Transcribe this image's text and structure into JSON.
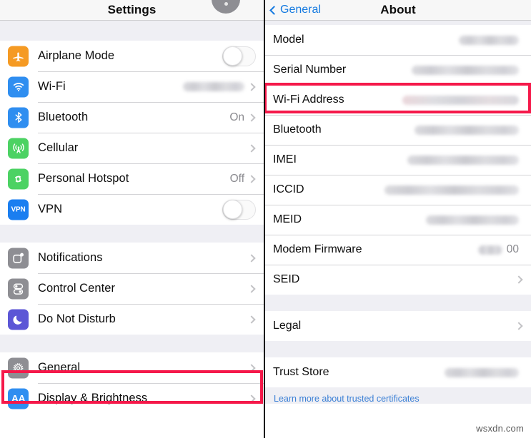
{
  "left_panel": {
    "nav": {
      "title": "Settings"
    },
    "groups": [
      {
        "items": [
          {
            "label": "Airplane Mode",
            "icon": "airplane-icon",
            "icon_color": "#f59a23",
            "accessory": "toggle",
            "toggle_on": false,
            "value": ""
          },
          {
            "label": "Wi-Fi",
            "icon": "wifi-icon",
            "icon_color": "#2f8ef0",
            "accessory": "chevron",
            "value": "",
            "redacted": true,
            "redact_width": 86
          },
          {
            "label": "Bluetooth",
            "icon": "bluetooth-icon",
            "icon_color": "#2f8ef0",
            "accessory": "chevron",
            "value": "On"
          },
          {
            "label": "Cellular",
            "icon": "cellular-icon",
            "icon_color": "#4cd263",
            "accessory": "chevron",
            "value": ""
          },
          {
            "label": "Personal Hotspot",
            "icon": "hotspot-icon",
            "icon_color": "#4cd263",
            "accessory": "chevron",
            "value": "Off"
          },
          {
            "label": "VPN",
            "icon": "vpn-icon",
            "icon_color": "#1a7ef0",
            "accessory": "toggle",
            "toggle_on": false,
            "value": ""
          }
        ]
      },
      {
        "items": [
          {
            "label": "Notifications",
            "icon": "notifications-icon",
            "icon_color": "#8e8e93",
            "accessory": "chevron",
            "value": ""
          },
          {
            "label": "Control Center",
            "icon": "control-center-icon",
            "icon_color": "#8e8e93",
            "accessory": "chevron",
            "value": ""
          },
          {
            "label": "Do Not Disturb",
            "icon": "moon-icon",
            "icon_color": "#5c56d6",
            "accessory": "chevron",
            "value": ""
          }
        ]
      },
      {
        "items": [
          {
            "label": "General",
            "icon": "gear-icon",
            "icon_color": "#8e8e93",
            "accessory": "chevron",
            "value": "",
            "highlighted": true
          },
          {
            "label": "Display & Brightness",
            "icon": "display-brightness-icon",
            "icon_color": "#2f8ef0",
            "accessory": "chevron",
            "value": ""
          }
        ]
      }
    ]
  },
  "right_panel": {
    "nav": {
      "back_label": "General",
      "title": "About"
    },
    "groups": [
      {
        "items": [
          {
            "label": "Model",
            "value": "",
            "redacted": true,
            "redact_width": 84,
            "accessory": "none"
          },
          {
            "label": "Serial Number",
            "value": "",
            "redacted": true,
            "redact_width": 150,
            "accessory": "none"
          },
          {
            "label": "Wi-Fi Address",
            "value": "",
            "redacted": true,
            "redact_width": 163,
            "redact_tint": "pink",
            "accessory": "none",
            "highlighted": true
          },
          {
            "label": "Bluetooth",
            "value": "",
            "redacted": true,
            "redact_width": 146,
            "accessory": "none"
          },
          {
            "label": "IMEI",
            "value": "",
            "redacted": true,
            "redact_width": 156,
            "accessory": "none"
          },
          {
            "label": "ICCID",
            "value": "",
            "redacted": true,
            "redact_width": 188,
            "accessory": "none"
          },
          {
            "label": "MEID",
            "value": "",
            "redacted": true,
            "redact_width": 130,
            "accessory": "none"
          },
          {
            "label": "Modem Firmware",
            "value": "00",
            "redacted": true,
            "redact_width": 34,
            "accessory": "none"
          },
          {
            "label": "SEID",
            "value": "",
            "accessory": "chevron"
          }
        ]
      },
      {
        "items": [
          {
            "label": "Legal",
            "value": "",
            "accessory": "chevron"
          }
        ]
      },
      {
        "items": [
          {
            "label": "Trust Store",
            "value": "",
            "redacted": true,
            "redact_width": 104,
            "accessory": "none"
          }
        ]
      }
    ],
    "footnote": "Learn more about trusted certificates"
  },
  "watermark": "wsxdn.com",
  "colors": {
    "highlight": "#f5194a",
    "link": "#3a7fd5",
    "group_bg": "#efeff4",
    "separator": "#d3d3d6"
  }
}
